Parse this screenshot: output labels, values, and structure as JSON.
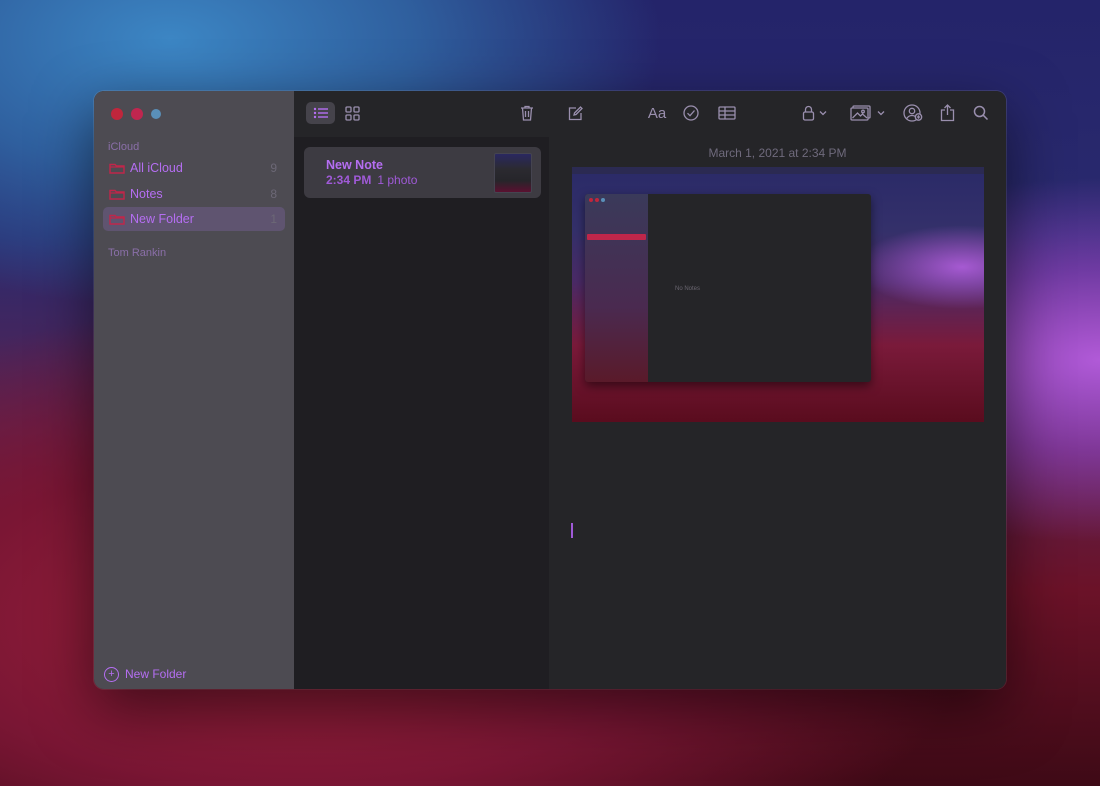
{
  "colors": {
    "accent": "#b56ef2",
    "close": "#c0263c",
    "sidebar_bg": "#4d4b52",
    "window_bg": "#252528",
    "selected_row": "#5f5470"
  },
  "sidebar": {
    "section_icloud": "iCloud",
    "folders": [
      {
        "label": "All iCloud",
        "count": "9",
        "icon": "folder-icon"
      },
      {
        "label": "Notes",
        "count": "8",
        "icon": "folder-icon"
      },
      {
        "label": "New Folder",
        "count": "1",
        "icon": "folder-icon",
        "selected": true
      }
    ],
    "section_account": "Tom Rankin",
    "new_folder_label": "New Folder"
  },
  "toolbar": {
    "icons": [
      "list-view-icon",
      "gallery-view-icon",
      "trash-icon",
      "compose-icon",
      "format-text-icon",
      "checklist-icon",
      "table-icon",
      "lock-icon",
      "media-icon",
      "collaborate-icon",
      "share-icon",
      "search-icon"
    ],
    "format_label": "Aa"
  },
  "notes": [
    {
      "title": "New Note",
      "time": "2:34 PM",
      "detail": "1 photo"
    }
  ],
  "editor": {
    "date": "March 1, 2021 at 2:34 PM",
    "embedded_screenshot": {
      "empty_label": "No Notes"
    }
  }
}
